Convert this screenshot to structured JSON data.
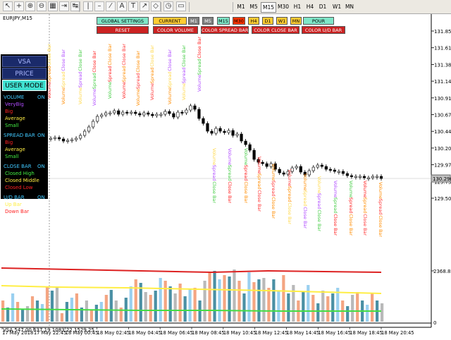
{
  "toolbar": {
    "icons": [
      "cursor-icon",
      "crosshair-icon",
      "zoom-in-icon",
      "zoom-out-icon",
      "grid-icon",
      "chart-scroll-icon",
      "autoscroll-icon",
      "vertical-line-icon",
      "horizontal-line-icon",
      "trendline-icon",
      "text-icon",
      "label-icon",
      "arrow-icon",
      "shapes-icon",
      "period-icon",
      "template-icon"
    ],
    "timeframes": [
      "M1",
      "M5",
      "M15",
      "M30",
      "H1",
      "H4",
      "D1",
      "W1",
      "MN"
    ],
    "active_timeframe": "M15"
  },
  "chart": {
    "symbol": "EURJPY,M15",
    "buttons_row1": [
      {
        "label": "GLOBAL SETTINGS",
        "color": "#7fe6c8"
      },
      {
        "label": "CURRENT",
        "color": "#ffcc33"
      },
      {
        "label": "M1",
        "color": "#808080"
      },
      {
        "label": "M5",
        "color": "#808080"
      },
      {
        "label": "M15",
        "color": "#7fe6c8"
      },
      {
        "label": "M30",
        "color": "#ff3300"
      },
      {
        "label": "H4",
        "color": "#ffcc33"
      },
      {
        "label": "D1",
        "color": "#ffcc33"
      },
      {
        "label": "W1",
        "color": "#ffcc33"
      },
      {
        "label": "MN",
        "color": "#ffcc33"
      },
      {
        "label": "POUR",
        "color": "#7fe6c8"
      }
    ],
    "buttons_row2": [
      {
        "label": "RESET",
        "color": "#cc2222"
      },
      {
        "label": "COLOR VOLUME",
        "color": "#cc2222"
      },
      {
        "label": "COLOR SPREAD BAR",
        "color": "#cc2222"
      },
      {
        "label": "COLOR CLOSE BAR",
        "color": "#cc2222"
      },
      {
        "label": "COLOR U/D BAR",
        "color": "#cc2222"
      }
    ],
    "panel": {
      "vsa": "VSA",
      "price_action": "PRICE ACTION",
      "user_mode": "USER MODE",
      "groups": [
        {
          "title": "VOLUME",
          "state": "ON",
          "items": [
            {
              "text": "VeryBig",
              "color": "#b04cff"
            },
            {
              "text": "Big",
              "color": "#ff2222"
            },
            {
              "text": "Average",
              "color": "#ffee44"
            },
            {
              "text": "Small",
              "color": "#44ee44"
            }
          ]
        },
        {
          "title": "SPREAD BAR",
          "state": "ON",
          "items": [
            {
              "text": "Big",
              "color": "#ff2222"
            },
            {
              "text": "Average",
              "color": "#ffee44"
            },
            {
              "text": "Small",
              "color": "#44ee44"
            }
          ]
        },
        {
          "title": "CLOSE BAR",
          "state": "ON",
          "items": [
            {
              "text": "Closed High",
              "color": "#44ee44"
            },
            {
              "text": "Closed Middle",
              "color": "#ffee44"
            },
            {
              "text": "Closed Low",
              "color": "#ff2222"
            }
          ]
        },
        {
          "title": "U/D BAR",
          "state": "ON",
          "items": [
            {
              "text": "Up Bar",
              "color": "#ffee44"
            },
            {
              "text": "Down Bar",
              "color": "#ff2222"
            }
          ]
        }
      ]
    },
    "price_axis": [
      "131.850",
      "131.615",
      "131.380",
      "131.145",
      "130.910",
      "130.675",
      "130.440",
      "130.205",
      "129.970",
      "129.735",
      "129.500"
    ],
    "current_price": "130.296",
    "vertical_annotation_text": [
      "Volume",
      "Spread",
      "Close Bar"
    ],
    "annotation_colors": [
      "#ff3333",
      "#ff8c00",
      "#ffd84a",
      "#b04cff",
      "#44cc44",
      "#ff2222",
      "#ff8c00"
    ],
    "vsa_indicator": {
      "label": "VSA 547.00 637.19 1083.22 1529.25",
      "scale_top": "2368.8",
      "scale_bottom": "0",
      "line_colors": {
        "red": "#dd2222",
        "yellow": "#ffee44",
        "green": "#44dd44"
      }
    },
    "time_axis": [
      "17 May 2018",
      "17 May 22:45",
      "18 May 00:45",
      "18 May 02:45",
      "18 May 04:45",
      "18 May 06:45",
      "18 May 08:45",
      "18 May 10:45",
      "18 May 12:45",
      "18 May 14:45",
      "18 May 16:45",
      "18 May 18:45",
      "18 May 20:45"
    ]
  }
}
